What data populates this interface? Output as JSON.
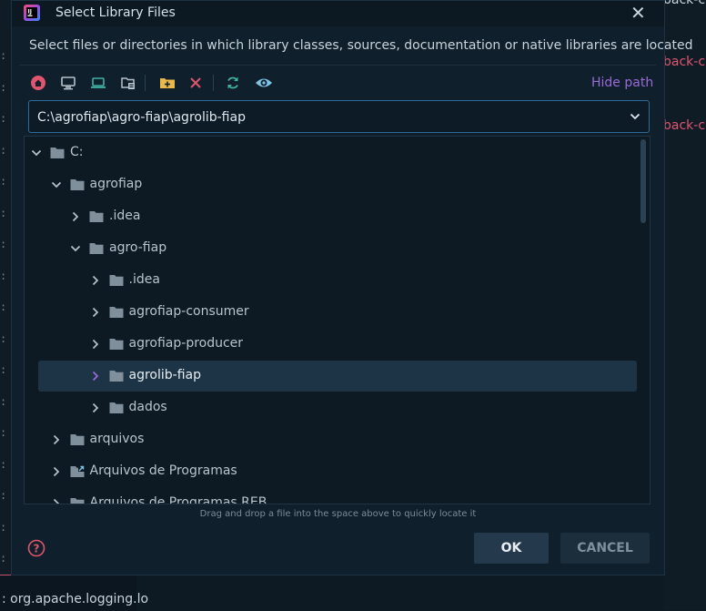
{
  "background": {
    "gutter_chars": [
      ":",
      ":",
      ":",
      ":",
      ":",
      ":",
      ":",
      ":",
      ":",
      ":",
      ":",
      ":",
      ":",
      ":",
      ":",
      ":",
      ":"
    ],
    "right_snippets": [
      {
        "text": "back-cl",
        "color": "#c9d4dc"
      },
      {
        "text": "back-cl",
        "color": "#e0556e"
      },
      {
        "text": "back-cl",
        "color": "#e0556e"
      }
    ],
    "bottom_text": ": org.apache.logging.lo"
  },
  "dialog": {
    "title": "Select Library Files",
    "description": "Select files or directories in which library classes, sources, documentation or native libraries are located",
    "hide_path_label": "Hide path",
    "path_value": "C:\\agrofiap\\agro-fiap\\agrolib-fiap",
    "hint": "Drag and drop a file into the space above to quickly locate it",
    "ok_label": "OK",
    "cancel_label": "CANCEL"
  },
  "toolbar": {
    "icons": [
      "home-icon",
      "desktop-icon",
      "laptop-icon",
      "project-icon",
      "new-folder-icon",
      "delete-icon",
      "refresh-icon",
      "show-hidden-icon"
    ]
  },
  "tree": [
    {
      "label": "C:",
      "depth": 0,
      "expanded": true,
      "folder_style": "plain",
      "selected": false
    },
    {
      "label": "agrofiap",
      "depth": 1,
      "expanded": true,
      "folder_style": "plain",
      "selected": false
    },
    {
      "label": ".idea",
      "depth": 2,
      "expanded": false,
      "folder_style": "plain",
      "selected": false
    },
    {
      "label": "agro-fiap",
      "depth": 2,
      "expanded": true,
      "folder_style": "plain",
      "selected": false
    },
    {
      "label": ".idea",
      "depth": 3,
      "expanded": false,
      "folder_style": "plain",
      "selected": false
    },
    {
      "label": "agrofiap-consumer",
      "depth": 3,
      "expanded": false,
      "folder_style": "plain",
      "selected": false
    },
    {
      "label": "agrofiap-producer",
      "depth": 3,
      "expanded": false,
      "folder_style": "plain",
      "selected": false
    },
    {
      "label": "agrolib-fiap",
      "depth": 3,
      "expanded": false,
      "folder_style": "plain",
      "selected": true
    },
    {
      "label": "dados",
      "depth": 3,
      "expanded": false,
      "folder_style": "plain",
      "selected": false
    },
    {
      "label": "arquivos",
      "depth": 1,
      "expanded": false,
      "folder_style": "plain",
      "selected": false
    },
    {
      "label": "Arquivos de Programas",
      "depth": 1,
      "expanded": false,
      "folder_style": "shortcut",
      "selected": false
    },
    {
      "label": "Arquivos de Programas REB",
      "depth": 1,
      "expanded": false,
      "folder_style": "plain",
      "selected": false
    }
  ],
  "colors": {
    "accent_purple": "#9b6ad9",
    "home_red": "#e0556e",
    "delete_red": "#e0556e",
    "refresh_teal": "#3fb2a3",
    "desktop_gray": "#b7c3cc",
    "laptop_teal": "#3fb2a3",
    "folder": "#7f8f9c",
    "new_folder_yellow": "#e8b84a",
    "eye_blue": "#7fc4e6"
  }
}
